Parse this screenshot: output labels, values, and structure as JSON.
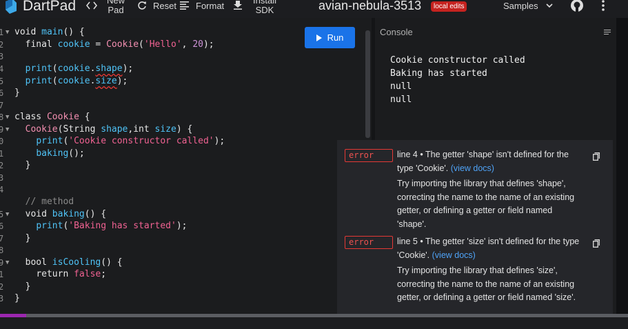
{
  "topbar": {
    "brand": "DartPad",
    "new_pad": [
      "New",
      "Pad"
    ],
    "reset": "Reset",
    "format": "Format",
    "install_sdk": [
      "Install",
      "SDK"
    ],
    "title": "avian-nebula-3513",
    "badge": "local edits",
    "samples": "Samples"
  },
  "editor": {
    "run_label": "Run",
    "lines": [
      {
        "n": "1",
        "fold": true
      },
      {
        "n": "2"
      },
      {
        "n": "3"
      },
      {
        "n": "4"
      },
      {
        "n": "5"
      },
      {
        "n": "6"
      },
      {
        "n": "7"
      },
      {
        "n": "8",
        "fold": true
      },
      {
        "n": "9",
        "fold": true
      },
      {
        "n": "0"
      },
      {
        "n": "1"
      },
      {
        "n": "2"
      },
      {
        "n": "3"
      },
      {
        "n": "4"
      },
      {
        "n": "5",
        "fold": true
      },
      {
        "n": "6"
      },
      {
        "n": "7"
      },
      {
        "n": "8"
      },
      {
        "n": "9",
        "fold": true
      },
      {
        "n": "1"
      },
      {
        "n": "2"
      },
      {
        "n": "3"
      }
    ]
  },
  "console": {
    "header": "Console",
    "output": [
      "Cookie constructor called",
      "Baking has started",
      "null",
      "null"
    ]
  },
  "problems": [
    {
      "badge": "error",
      "message": "line 4 • The getter 'shape' isn't defined for the type 'Cookie'.",
      "link": "(view docs)",
      "hint": "Try importing the library that defines 'shape', correcting the name to the name of an existing getter, or defining a getter or field named 'shape'."
    },
    {
      "badge": "error",
      "message": "line 5 • The getter 'size' isn't defined for the type 'Cookie'.",
      "link": "(view docs)",
      "hint": "Try importing the library that defines 'size', correcting the name to the name of an existing getter, or defining a getter or field named 'size'."
    }
  ],
  "icons": {
    "code": "code-brackets-icon",
    "reset": "refresh-icon",
    "format": "format-lines-icon",
    "install": "download-icon",
    "samples": "chevron-down-icon",
    "github": "github-icon",
    "more": "more-vert-icon"
  }
}
